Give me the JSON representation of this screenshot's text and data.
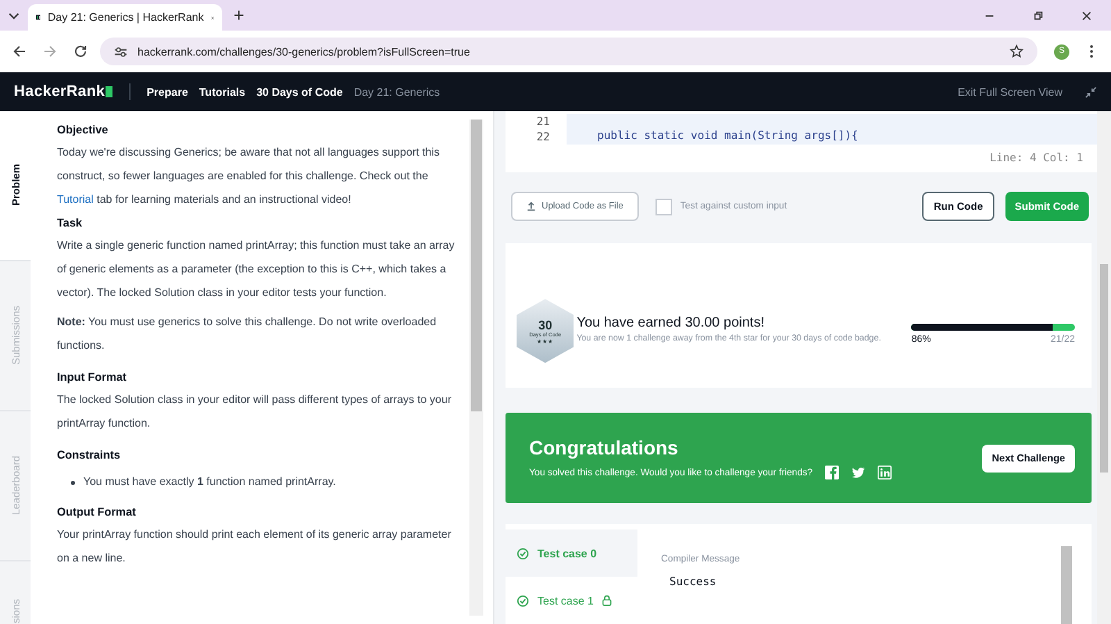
{
  "browser": {
    "tab_title": "Day 21: Generics | HackerRank",
    "url": "hackerrank.com/challenges/30-generics/problem?isFullScreen=true",
    "profile_initial": "S"
  },
  "nav": {
    "logo": "HackerRank",
    "breadcrumbs": [
      {
        "label": "Prepare",
        "current": false
      },
      {
        "label": "Tutorials",
        "current": false
      },
      {
        "label": "30 Days of Code",
        "current": false
      },
      {
        "label": "Day 21: Generics",
        "current": true
      }
    ],
    "exit_fullscreen": "Exit Full Screen View"
  },
  "side_tabs": [
    {
      "label": "Problem",
      "selected": true
    },
    {
      "label": "Submissions",
      "selected": false
    },
    {
      "label": "Leaderboard",
      "selected": false
    },
    {
      "label": "sions",
      "selected": false
    }
  ],
  "problem": {
    "sections": [
      {
        "heading": "Objective",
        "paragraphs": [
          {
            "before": "Today we're discussing Generics; be aware that not all languages support this construct, so fewer languages are enabled for this challenge. Check out the ",
            "link": "Tutorial",
            "after": " tab for learning materials and an instructional video!"
          }
        ]
      },
      {
        "heading": "Task",
        "paragraphs": [
          {
            "text": "Write a single generic function named printArray; this function must take an array of generic elements as a parameter (the exception to this is C++, which takes a vector). The locked Solution class in your editor tests your function."
          },
          {
            "text": "**Note:** You must use generics to solve this challenge. Do not write overloaded functions."
          }
        ]
      },
      {
        "heading": "Input Format",
        "paragraphs": [
          {
            "text": "The locked Solution class in your editor will pass different types of arrays to your printArray function."
          }
        ]
      },
      {
        "heading": "Constraints",
        "bullets": [
          "You must have exactly **1** function named printArray."
        ]
      },
      {
        "heading": "Output Format",
        "paragraphs": [
          {
            "text": "Your printArray function should print each element of its generic array parameter on a new line."
          }
        ]
      }
    ]
  },
  "editor": {
    "lines": [
      {
        "number": "21"
      },
      {
        "number": "22",
        "code": "public static void main(String args[]){"
      }
    ],
    "cursor": "Line: 4 Col: 1"
  },
  "actions": {
    "upload": "Upload Code as File",
    "custom_input": {
      "label": "Test against custom input",
      "checked": false
    },
    "run": "Run Code",
    "submit": "Submit Code"
  },
  "result": {
    "badge_number": "30",
    "badge_label": "Days of Code",
    "badge_stars": "★★★",
    "title": "You have earned 30.00 points!",
    "subtitle": "You are now 1 challenge away from the 4th star for your 30 days of code badge.",
    "progress": {
      "level": 0.86,
      "percent": "86%",
      "count": "21/22"
    }
  },
  "congrats": {
    "title": "Congratulations",
    "message": "You solved this challenge. Would you like to challenge your friends?",
    "next": "Next Challenge"
  },
  "test_cases": [
    {
      "label": "Test case 0",
      "selected": true,
      "locked": false
    },
    {
      "label": "Test case 1",
      "selected": false,
      "locked": true
    }
  ],
  "compiler": {
    "heading": "Compiler Message",
    "message": "Success"
  }
}
